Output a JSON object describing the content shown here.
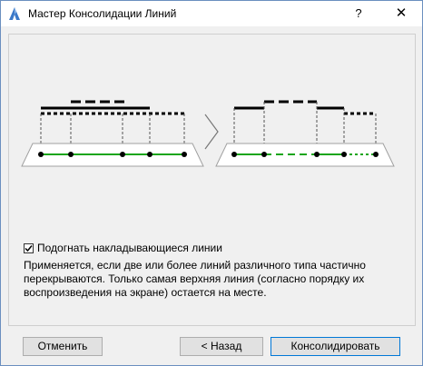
{
  "window": {
    "title": "Мастер Консолидации Линий",
    "help_label": "?",
    "close_label": "✕"
  },
  "illustration": {
    "icons": [
      "dotted-line-icon",
      "dashed-line-icon",
      "solid-line-icon",
      "arrow-right-icon"
    ],
    "colors": {
      "line": "#000000",
      "green": "#1aa51a",
      "trapezoid_border": "#a0a0a0",
      "trapezoid_fill": "#ffffff"
    }
  },
  "option": {
    "checked": true,
    "label": "Подогнать накладывающиеся линии"
  },
  "description": "Применяется, если две или более линий различного типа частично перекрываются. Только самая верхняя линия (согласно порядку их воспроизведения на экране) остается на месте.",
  "buttons": {
    "cancel": "Отменить",
    "back": "< Назад",
    "consolidate": "Консолидировать"
  }
}
